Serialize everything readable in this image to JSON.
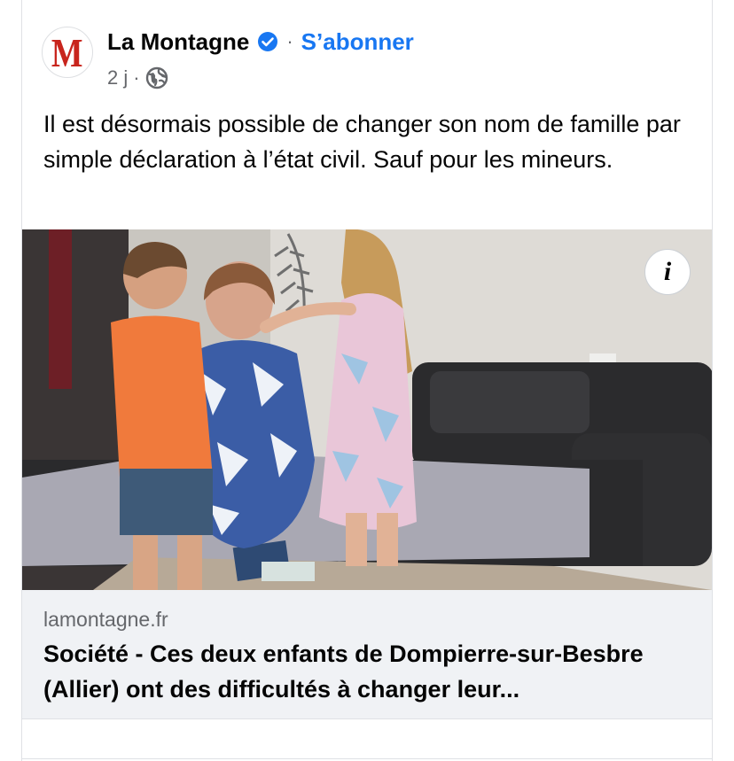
{
  "post": {
    "page_name": "La Montagne",
    "avatar_letter": "M",
    "separator": "·",
    "subscribe_label": "S’abonner",
    "time": "2 j",
    "text": "Il est désormais possible de changer son nom de famille par simple déclaration à l’état civil. Sauf pour les mineurs."
  },
  "link": {
    "domain": "lamontagne.fr",
    "title": "Société - Ces deux enfants de Dompierre-sur-Besbre (Allier) ont des difficultés à changer leur..."
  },
  "image": {
    "info_label": "i"
  },
  "colors": {
    "brand_red": "#c8251d",
    "link_blue": "#1877f2",
    "secondary_text": "#65676b",
    "preview_bg": "#f0f2f5"
  },
  "icons": [
    "verified-badge-icon",
    "globe-icon",
    "info-icon"
  ]
}
